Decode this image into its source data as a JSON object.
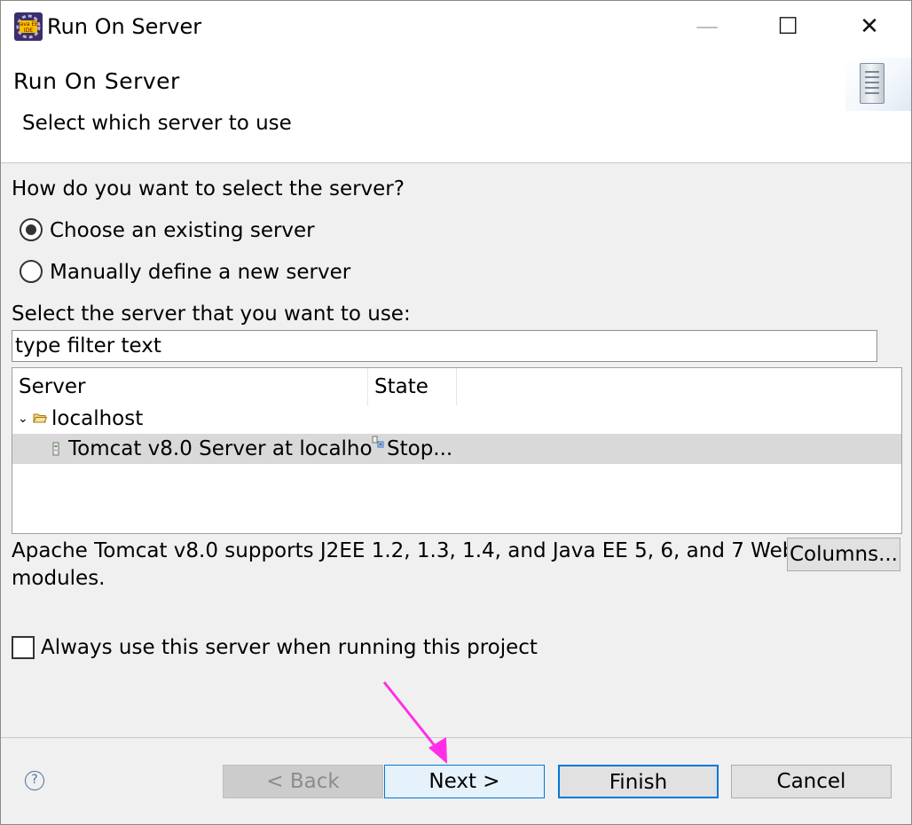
{
  "window": {
    "title": "Run On Server",
    "icon_name": "java-ee-ide-icon",
    "controls": {
      "minimize": "—",
      "maximize": "☐",
      "close": "✕"
    }
  },
  "banner": {
    "title": "Run On Server",
    "description": "Select which server to use",
    "image_icon": "server-icon"
  },
  "selection": {
    "question": "How do you want to select the server?",
    "options": [
      {
        "label": "Choose an existing server",
        "checked": true
      },
      {
        "label": "Manually define a new server",
        "checked": false
      }
    ],
    "list_label": "Select the server that you want to use:",
    "filter": {
      "value": "type filter text",
      "placeholder": "type filter text"
    }
  },
  "server_table": {
    "columns": [
      "Server",
      "State"
    ],
    "rows": [
      {
        "expander": "⌄",
        "icon": "folder-icon",
        "server": "localhost",
        "state": "",
        "selected": false
      },
      {
        "icon": "tomcat-server-icon",
        "server": "Tomcat v8.0 Server at localho",
        "state_icon": "stopped-state-icon",
        "state": "Stop...",
        "selected": true
      }
    ]
  },
  "description": {
    "line1": "Apache Tomcat v8.0 supports J2EE 1.2, 1.3, 1.4, and Java EE 5, 6, and 7 Web",
    "line2": "modules.",
    "columns_button": "Columns..."
  },
  "always_use": {
    "label": "Always use this server when running this project",
    "checked": false
  },
  "footer": {
    "help_icon": "help-icon",
    "help_glyph": "?",
    "back": "< Back",
    "next": "Next >",
    "finish": "Finish",
    "cancel": "Cancel"
  },
  "colors": {
    "accent": "#0078d7",
    "selected_row": "#d9d9d9",
    "annotation_arrow": "#ff2ee6"
  }
}
